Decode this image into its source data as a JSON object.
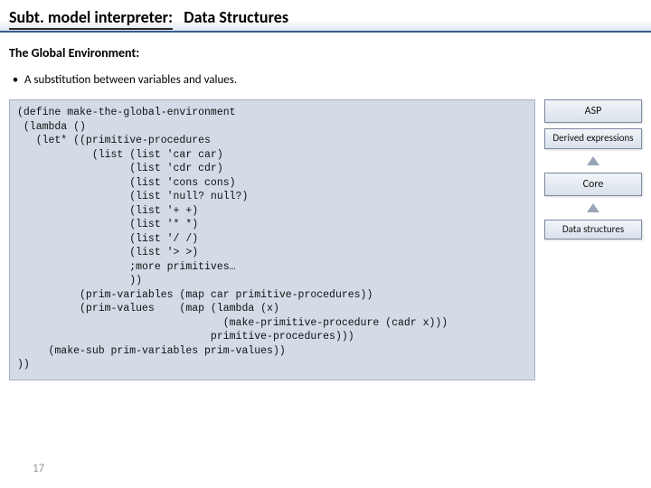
{
  "header": {
    "prefix": "Subt. model interpreter:",
    "topic": "Data Structures"
  },
  "section_title": "The Global Environment:",
  "bullet_text": "A substitution between variables and values.",
  "code": "(define make-the-global-environment\n (lambda ()\n   (let* ((primitive-procedures\n            (list (list 'car car)\n                  (list 'cdr cdr)\n                  (list 'cons cons)\n                  (list 'null? null?)\n                  (list '+ +)\n                  (list '* *)\n                  (list '/ /)\n                  (list '> >)\n                  ;more primitives…\n                  ))\n          (prim-variables (map car primitive-procedures))\n          (prim-values    (map (lambda (x)\n                                 (make-primitive-procedure (cadr x)))\n                               primitive-procedures)))\n     (make-sub prim-variables prim-values))\n))",
  "side": {
    "asp": "ASP",
    "derived": "Derived expressions",
    "core": "Core",
    "data": "Data structures"
  },
  "page_number": "17"
}
